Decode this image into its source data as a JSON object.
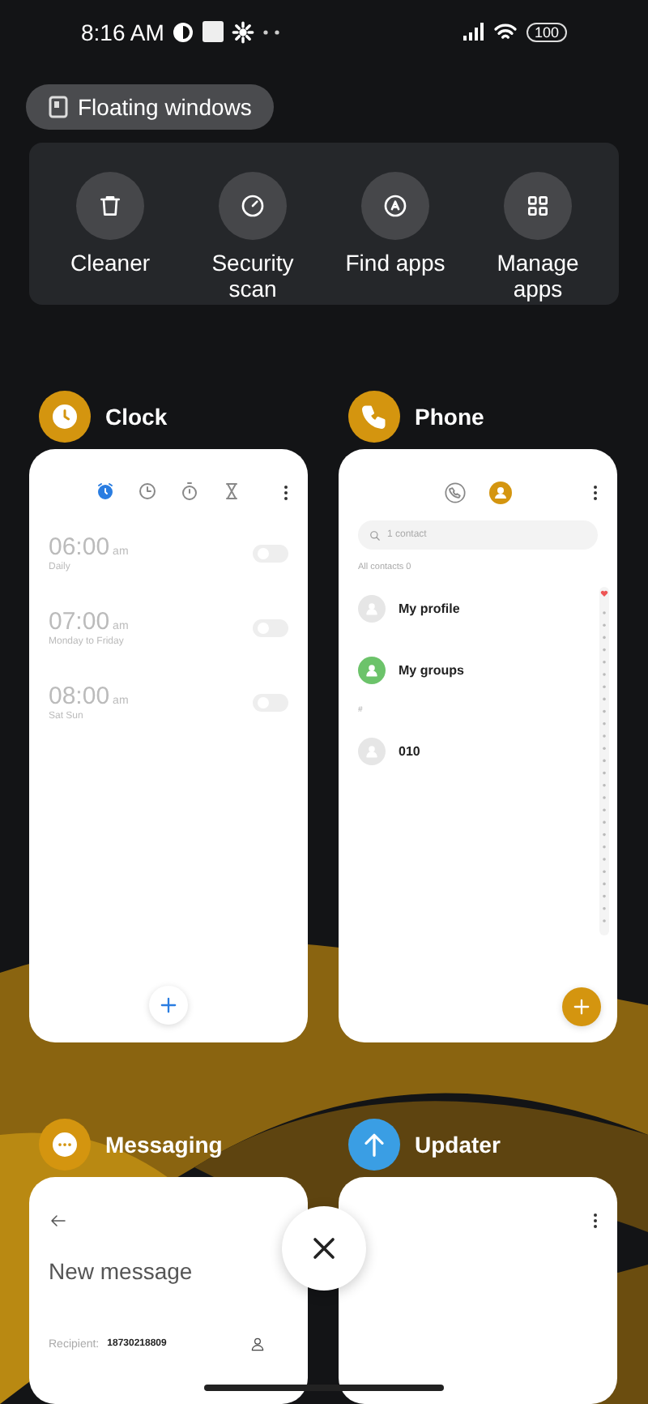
{
  "status_bar": {
    "time": "8:16 AM",
    "battery": "100"
  },
  "floating_windows": {
    "label": "Floating windows"
  },
  "quick_actions": [
    {
      "kind": "cleaner",
      "label": "Cleaner"
    },
    {
      "kind": "security",
      "label": "Security scan"
    },
    {
      "kind": "find",
      "label": "Find apps"
    },
    {
      "kind": "manage",
      "label": "Manage apps"
    }
  ],
  "apps": [
    {
      "kind": "clock",
      "name": "Clock",
      "color": "#d4950f",
      "tabs": [
        {
          "kind": "alarm",
          "selected": true
        },
        {
          "kind": "world",
          "selected": false
        },
        {
          "kind": "stopwatch",
          "selected": false
        },
        {
          "kind": "timer",
          "selected": false
        }
      ],
      "alarms": [
        {
          "time": "06:00",
          "ampm": "am",
          "repeat": "Daily",
          "on": false
        },
        {
          "time": "07:00",
          "ampm": "am",
          "repeat": "Monday to Friday",
          "on": false
        },
        {
          "time": "08:00",
          "ampm": "am",
          "repeat": "Sat Sun",
          "on": false
        }
      ]
    },
    {
      "kind": "phone",
      "name": "Phone",
      "color": "#d4950f",
      "tabs": [
        {
          "kind": "calls",
          "selected": false
        },
        {
          "kind": "contacts",
          "selected": true
        }
      ],
      "search": {
        "placeholder": "1 contact"
      },
      "filter": "All contacts",
      "filter_count": "0",
      "rows": [
        {
          "kind": "profile",
          "label": "My profile"
        },
        {
          "kind": "groups",
          "label": "My groups"
        },
        {
          "kind": "section",
          "label": "#"
        },
        {
          "kind": "contact",
          "label": "010"
        }
      ]
    },
    {
      "kind": "messaging",
      "name": "Messaging",
      "color": "#d4950f",
      "title": "New message",
      "recipient_label": "Recipient:",
      "recipient": "18730218809"
    },
    {
      "kind": "updater",
      "name": "Updater",
      "color": "#3a9ee4"
    }
  ]
}
